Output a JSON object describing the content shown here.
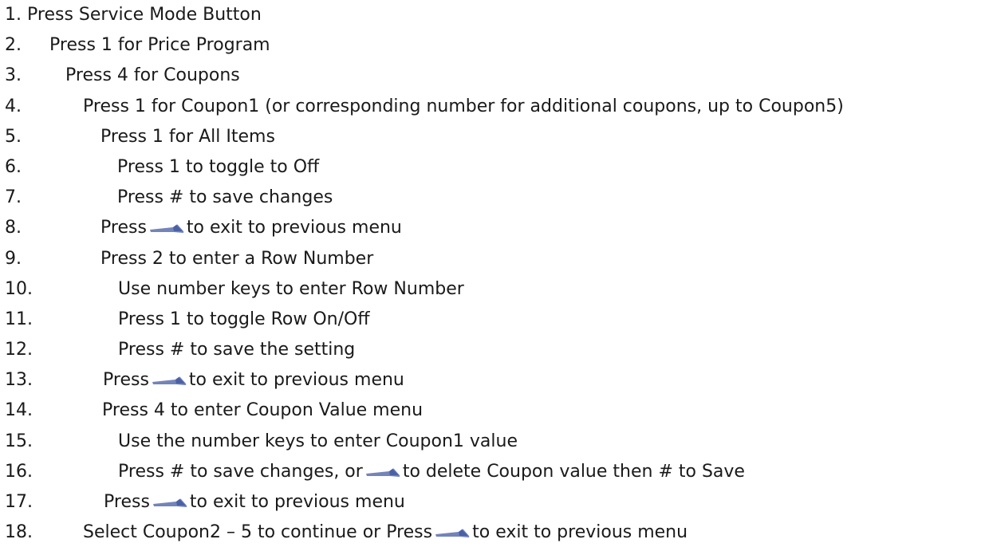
{
  "steps": [
    {
      "num": "1.",
      "parts": [
        "Press Service Mode Button"
      ]
    },
    {
      "num": "2.",
      "parts": [
        "Press 1 for Price Program"
      ]
    },
    {
      "num": "3.",
      "parts": [
        "Press 4 for Coupons"
      ]
    },
    {
      "num": "4.",
      "parts": [
        "Press 1 for Coupon1 (or corresponding number for additional coupons, up to Coupon5)"
      ]
    },
    {
      "num": "5.",
      "parts": [
        "Press 1 for All Items"
      ]
    },
    {
      "num": "6.",
      "parts": [
        "Press 1 to toggle to Off"
      ]
    },
    {
      "num": "7.",
      "parts": [
        "Press # to save changes"
      ]
    },
    {
      "num": "8.",
      "parts": [
        "Press",
        "to exit to previous menu"
      ]
    },
    {
      "num": "9.",
      "parts": [
        "Press 2 to enter a Row Number"
      ]
    },
    {
      "num": "10.",
      "parts": [
        "Use number keys to enter Row Number"
      ]
    },
    {
      "num": "11.",
      "parts": [
        "Press 1 to toggle Row On/Off"
      ]
    },
    {
      "num": "12.",
      "parts": [
        "Press # to save the setting"
      ]
    },
    {
      "num": "13.",
      "parts": [
        "Press",
        "to exit to previous menu"
      ]
    },
    {
      "num": "14.",
      "parts": [
        "Press 4 to enter Coupon Value menu"
      ]
    },
    {
      "num": "15.",
      "parts": [
        "Use the number keys to enter Coupon1 value"
      ]
    },
    {
      "num": "16.",
      "parts": [
        "Press # to save changes, or",
        "to delete Coupon value then # to Save"
      ]
    },
    {
      "num": "17.",
      "parts": [
        "Press",
        "to exit to previous menu"
      ]
    },
    {
      "num": "18.",
      "parts": [
        "Select Coupon2 – 5 to continue or Press",
        "to exit to previous menu"
      ]
    }
  ],
  "icons": {
    "back_key": "back-key-icon",
    "back_key_color": "#5a6fae"
  }
}
